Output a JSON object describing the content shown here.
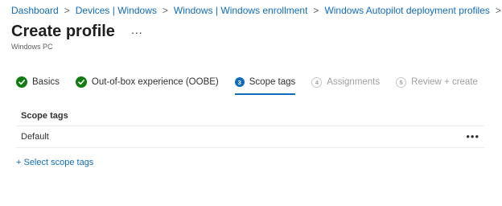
{
  "breadcrumb": {
    "items": [
      "Dashboard",
      "Devices | Windows",
      "Windows | Windows enrollment",
      "Windows Autopilot deployment profiles"
    ],
    "separator": ">"
  },
  "header": {
    "title": "Create profile",
    "more": "...",
    "subtitle": "Windows PC"
  },
  "wizard": {
    "steps": [
      {
        "label": "Basics",
        "state": "done",
        "marker": "✓"
      },
      {
        "label": "Out-of-box experience (OOBE)",
        "state": "done",
        "marker": "✓"
      },
      {
        "label": "Scope tags",
        "state": "active",
        "marker": "3"
      },
      {
        "label": "Assignments",
        "state": "disabled",
        "marker": "4"
      },
      {
        "label": "Review + create",
        "state": "disabled",
        "marker": "5"
      }
    ]
  },
  "table": {
    "header": "Scope tags",
    "rows": [
      {
        "name": "Default",
        "more": "•••"
      }
    ]
  },
  "actions": {
    "select_scope_tags": "+ Select scope tags"
  },
  "colors": {
    "accent": "#0f6cbd",
    "success": "#107c10",
    "disabled": "#a19f9d"
  }
}
